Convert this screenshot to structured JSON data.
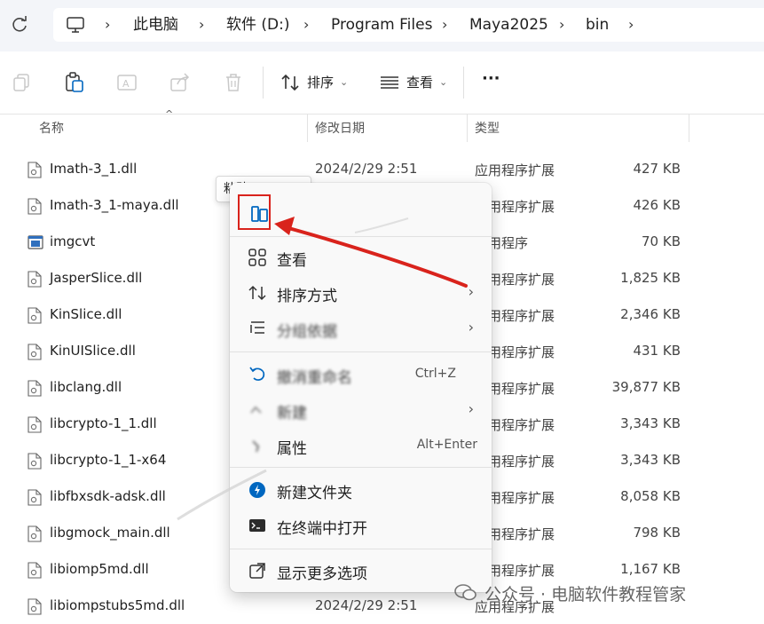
{
  "breadcrumb": [
    {
      "label": "此电脑"
    },
    {
      "label": "软件 (D:)"
    },
    {
      "label": "Program Files"
    },
    {
      "label": "Maya2025"
    },
    {
      "label": "bin"
    }
  ],
  "toolbar": {
    "sort_label": "排序",
    "view_label": "查看",
    "more_label": "···"
  },
  "columns": {
    "name": "名称",
    "date": "修改日期",
    "type": "类型"
  },
  "files": [
    {
      "name": "Imath-3_1.dll",
      "date": "2024/2/29 2:51",
      "type": "应用程序扩展",
      "size": "427 KB",
      "icon": "dll-file-icon"
    },
    {
      "name": "Imath-3_1-maya.dll",
      "date": "",
      "type": "应用程序扩展",
      "size": "426 KB",
      "icon": "dll-file-icon"
    },
    {
      "name": "imgcvt",
      "date": "",
      "type": "应用程序",
      "size": "70 KB",
      "icon": "exe-file-icon"
    },
    {
      "name": "JasperSlice.dll",
      "date": "",
      "type": "应用程序扩展",
      "size": "1,825 KB",
      "icon": "dll-file-icon"
    },
    {
      "name": "KinSlice.dll",
      "date": "",
      "type": "应用程序扩展",
      "size": "2,346 KB",
      "icon": "dll-file-icon"
    },
    {
      "name": "KinUISlice.dll",
      "date": "",
      "type": "应用程序扩展",
      "size": "431 KB",
      "icon": "dll-file-icon"
    },
    {
      "name": "libclang.dll",
      "date": "",
      "type": "应用程序扩展",
      "size": "39,877 KB",
      "icon": "dll-file-icon"
    },
    {
      "name": "libcrypto-1_1.dll",
      "date": "",
      "type": "应用程序扩展",
      "size": "3,343 KB",
      "icon": "dll-file-icon"
    },
    {
      "name": "libcrypto-1_1-x64",
      "date": "",
      "type": "应用程序扩展",
      "size": "3,343 KB",
      "icon": "dll-file-icon"
    },
    {
      "name": "libfbxsdk-adsk.dll",
      "date": "",
      "type": "应用程序扩展",
      "size": "8,058 KB",
      "icon": "dll-file-icon"
    },
    {
      "name": "libgmock_main.dll",
      "date": "",
      "type": "应用程序扩展",
      "size": "798 KB",
      "icon": "dll-file-icon"
    },
    {
      "name": "libiomp5md.dll",
      "date": "",
      "type": "应用程序扩展",
      "size": "1,167 KB",
      "icon": "dll-file-icon"
    },
    {
      "name": "libiompstubs5md.dll",
      "date": "2024/2/29 2:51",
      "type": "应用程序扩展",
      "size": "",
      "icon": "dll-file-icon"
    }
  ],
  "tooltip": "粘贴 (Ctrl+V)",
  "context_menu": {
    "view": "查看",
    "sort": "排序方式",
    "group": "分组依据",
    "undo": "撤消重命名",
    "undo_shortcut": "Ctrl+Z",
    "new": "新建",
    "properties": "属性",
    "properties_shortcut": "Alt+Enter",
    "new_folder": "新建文件夹",
    "open_terminal": "在终端中打开",
    "more_options": "显示更多选项"
  },
  "watermark": "公众号 · 电脑软件教程管家",
  "colors": {
    "highlight_box": "#d9231c",
    "arrow": "#d9231c",
    "accent": "#0067c0"
  }
}
